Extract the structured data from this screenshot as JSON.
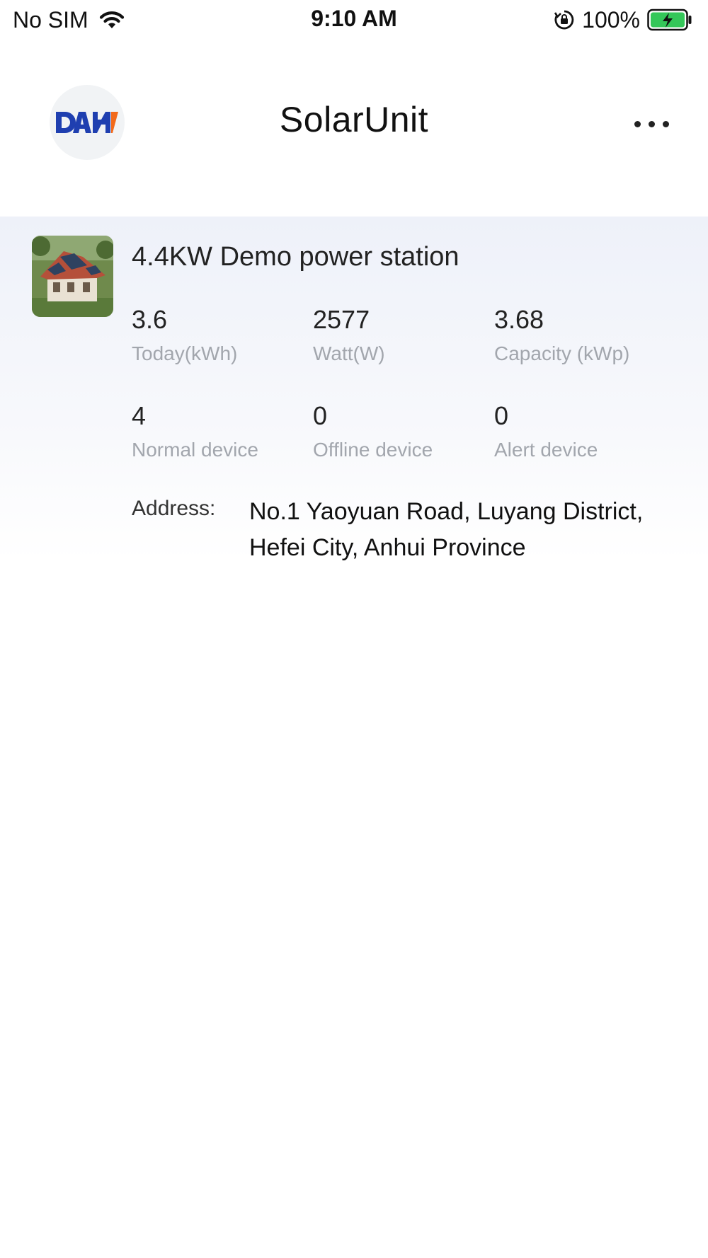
{
  "status_bar": {
    "carrier": "No SIM",
    "time": "9:10 AM",
    "battery_percent": "100%",
    "icons": [
      "wifi-icon",
      "lock-rotation-icon",
      "battery-charging-icon"
    ]
  },
  "header": {
    "title": "SolarUnit",
    "logo_text": "DAH",
    "more_icon": "more-horizontal-icon"
  },
  "station": {
    "name": "4.4KW Demo power station",
    "stats": [
      {
        "value": "3.6",
        "label": "Today(kWh)"
      },
      {
        "value": "2577",
        "label": "Watt(W)"
      },
      {
        "value": "3.68",
        "label": "Capacity (kWp)"
      },
      {
        "value": "4",
        "label": "Normal device"
      },
      {
        "value": "0",
        "label": "Offline device"
      },
      {
        "value": "0",
        "label": "Alert device"
      }
    ],
    "address_label": "Address:",
    "address": "No.1 Yaoyuan Road, Luyang District, Hefei City, Anhui Province"
  },
  "colors": {
    "logo_blue": "#1f3fb0",
    "logo_orange": "#f26a1b",
    "battery_green": "#34c759",
    "label_gray": "#a2a6ad",
    "card_bg_top": "#eef1f9"
  }
}
